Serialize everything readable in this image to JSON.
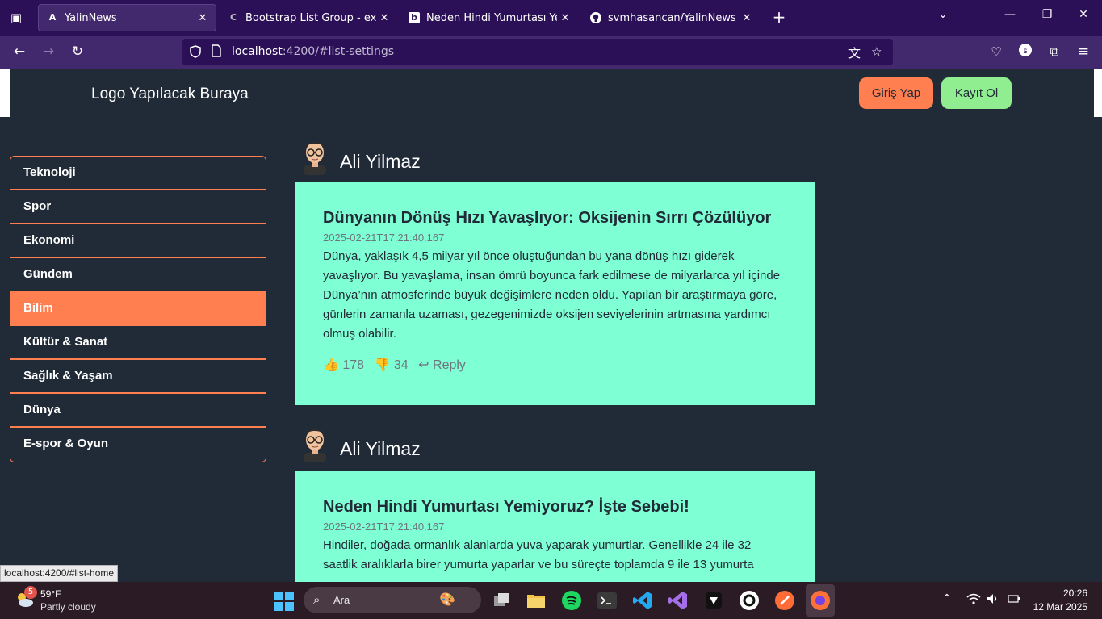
{
  "browser": {
    "tabs": [
      {
        "title": "YalinNews",
        "favicon": "A"
      },
      {
        "title": "Bootstrap List Group - extended",
        "favicon": "C"
      },
      {
        "title": "Neden Hindi Yumurtası Yemiyoruz",
        "favicon": "b"
      },
      {
        "title": "svmhasancan/YalinNews",
        "favicon": "gh"
      }
    ],
    "url_host": "localhost",
    "url_rest": ":4200/#list-settings"
  },
  "header": {
    "logo_text": "Logo Yapılacak Buraya",
    "login_label": "Giriş Yap",
    "register_label": "Kayıt Ol"
  },
  "sidebar": {
    "items": [
      {
        "label": "Teknoloji",
        "active": false
      },
      {
        "label": "Spor",
        "active": false
      },
      {
        "label": "Ekonomi",
        "active": false
      },
      {
        "label": "Gündem",
        "active": false
      },
      {
        "label": "Bilim",
        "active": true
      },
      {
        "label": "Kültür & Sanat",
        "active": false
      },
      {
        "label": "Sağlık & Yaşam",
        "active": false
      },
      {
        "label": "Dünya",
        "active": false
      },
      {
        "label": "E-spor & Oyun",
        "active": false
      }
    ]
  },
  "posts": [
    {
      "author": "Ali Yilmaz",
      "title": "Dünyanın Dönüş Hızı Yavaşlıyor: Oksijenin Sırrı Çözülüyor",
      "date": "2025-02-21T17:21:40.167",
      "body": "Dünya, yaklaşık 4,5 milyar yıl önce oluştuğundan bu yana dönüş hızı giderek yavaşlıyor. Bu yavaşlama, insan ömrü boyunca fark edilmese de milyarlarca yıl içinde Dünya’nın atmosferinde büyük değişimlere neden oldu. Yapılan bir araştırmaya göre, günlerin zamanla uzaması, gezegenimizde oksijen seviyelerinin artmasına yardımcı olmuş olabilir.",
      "likes": "178",
      "dislikes": "34",
      "reply_label": "Reply"
    },
    {
      "author": "Ali Yilmaz",
      "title": "Neden Hindi Yumurtası Yemiyoruz? İşte Sebebi!",
      "date": "2025-02-21T17:21:40.167",
      "body": "Hindiler, doğada ormanlık alanlarda yuva yaparak yumurtlar. Genellikle 24 ile 32 saatlik aralıklarla birer yumurta yaparlar ve bu süreçte toplamda 9 ile 13 yumurta"
    }
  ],
  "status_url": "localhost:4200/#list-home",
  "taskbar": {
    "weather_badge": "5",
    "weather_temp": "59°F",
    "weather_desc": "Partly cloudy",
    "search_placeholder": "Ara",
    "time": "20:26",
    "date": "12 Mar 2025"
  },
  "colors": {
    "accent": "#ff7f50",
    "register": "#90ee90",
    "card_bg": "#7fffd4",
    "page_bg": "#212b38"
  }
}
